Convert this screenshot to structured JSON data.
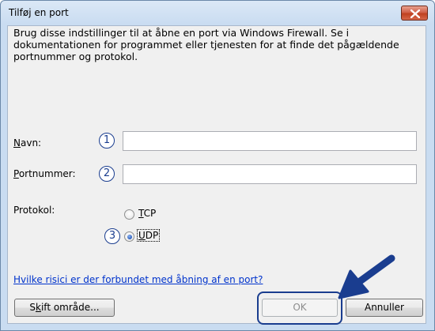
{
  "window": {
    "title": "Tilføj en port"
  },
  "description": "Brug disse indstillinger til at åbne en port via Windows Firewall. Se i dokumentationen for programmet eller tjenesten for at finde det pågældende portnummer og protokol.",
  "fields": {
    "name_label": "Navn:",
    "name_mnemonic": "N",
    "name_rest": "avn:",
    "name_value": "",
    "port_label": "Portnummer:",
    "port_mnemonic": "P",
    "port_rest": "ortnummer:",
    "port_value": ""
  },
  "protocol": {
    "label": "Protokol:",
    "options": [
      {
        "label": "TCP",
        "mnemonic": "T",
        "rest": "CP",
        "checked": false
      },
      {
        "label": "UDP",
        "mnemonic": "U",
        "rest": "DP",
        "checked": true
      }
    ]
  },
  "callouts": [
    "1",
    "2",
    "3"
  ],
  "link": "Hvilke risici er der forbundet med åbning af en port?",
  "buttons": {
    "change_scope_pre": "S",
    "change_scope_mnemonic": "k",
    "change_scope_post": "ift område...",
    "ok": "OK",
    "cancel": "Annuller"
  },
  "colors": {
    "callout": "#1a3d8f",
    "link": "#0033cc",
    "close": "#c0401f"
  }
}
